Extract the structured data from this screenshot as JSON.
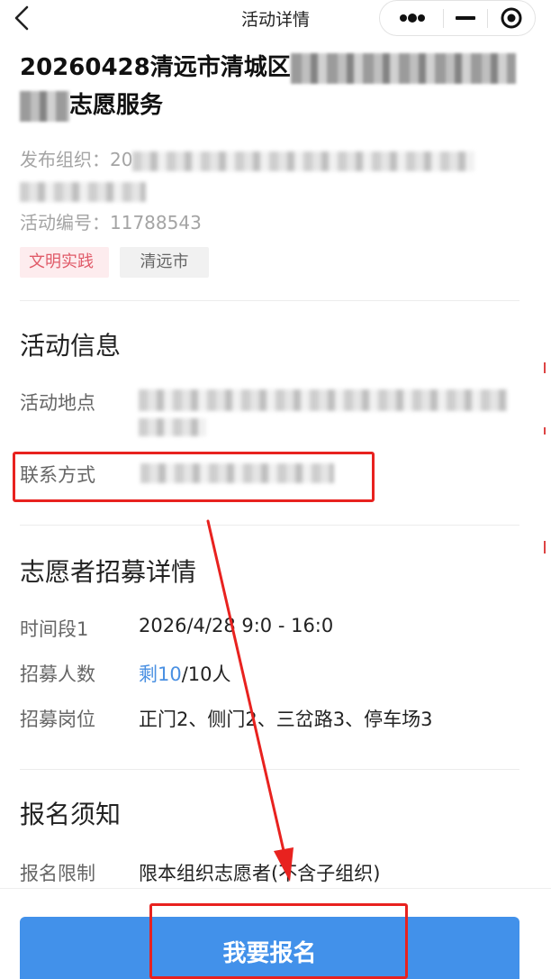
{
  "nav": {
    "title": "活动详情",
    "back_icon": "chevron-left-icon",
    "more_icon": "more-dots-icon",
    "minimize_icon": "minus-icon",
    "close_icon": "target-circle-icon"
  },
  "activity": {
    "title_line1": "20260428清远市清城区",
    "title_line2_suffix": "志愿服务",
    "publisher_label": "发布组织：",
    "publisher_value_visible": "20",
    "activity_number_label": "活动编号：",
    "activity_number": "11788543",
    "tags": [
      "文明实践",
      "清远市"
    ]
  },
  "info_section": {
    "title": "活动信息",
    "location_label": "活动地点",
    "contact_label": "联系方式"
  },
  "recruit_section": {
    "title": "志愿者招募详情",
    "time_label": "时间段1",
    "time_value": "2026/4/28 9:0 - 16:0",
    "count_label": "招募人数",
    "count_remaining": "剩10",
    "count_total": "/10人",
    "positions_label": "招募岗位",
    "positions_value": "正门2、侧门2、三岔路3、停车场3"
  },
  "notice_section": {
    "title": "报名须知",
    "limit_label": "报名限制",
    "limit_value": "限本组织志愿者(不含子组织)"
  },
  "action": {
    "signup_label": "我要报名"
  },
  "colors": {
    "accent": "#4a90e2",
    "primary_button": "#4291ea",
    "tag_red_bg": "#fdecee",
    "tag_red_text": "#e05a68",
    "annotation_red": "#e8221f"
  }
}
